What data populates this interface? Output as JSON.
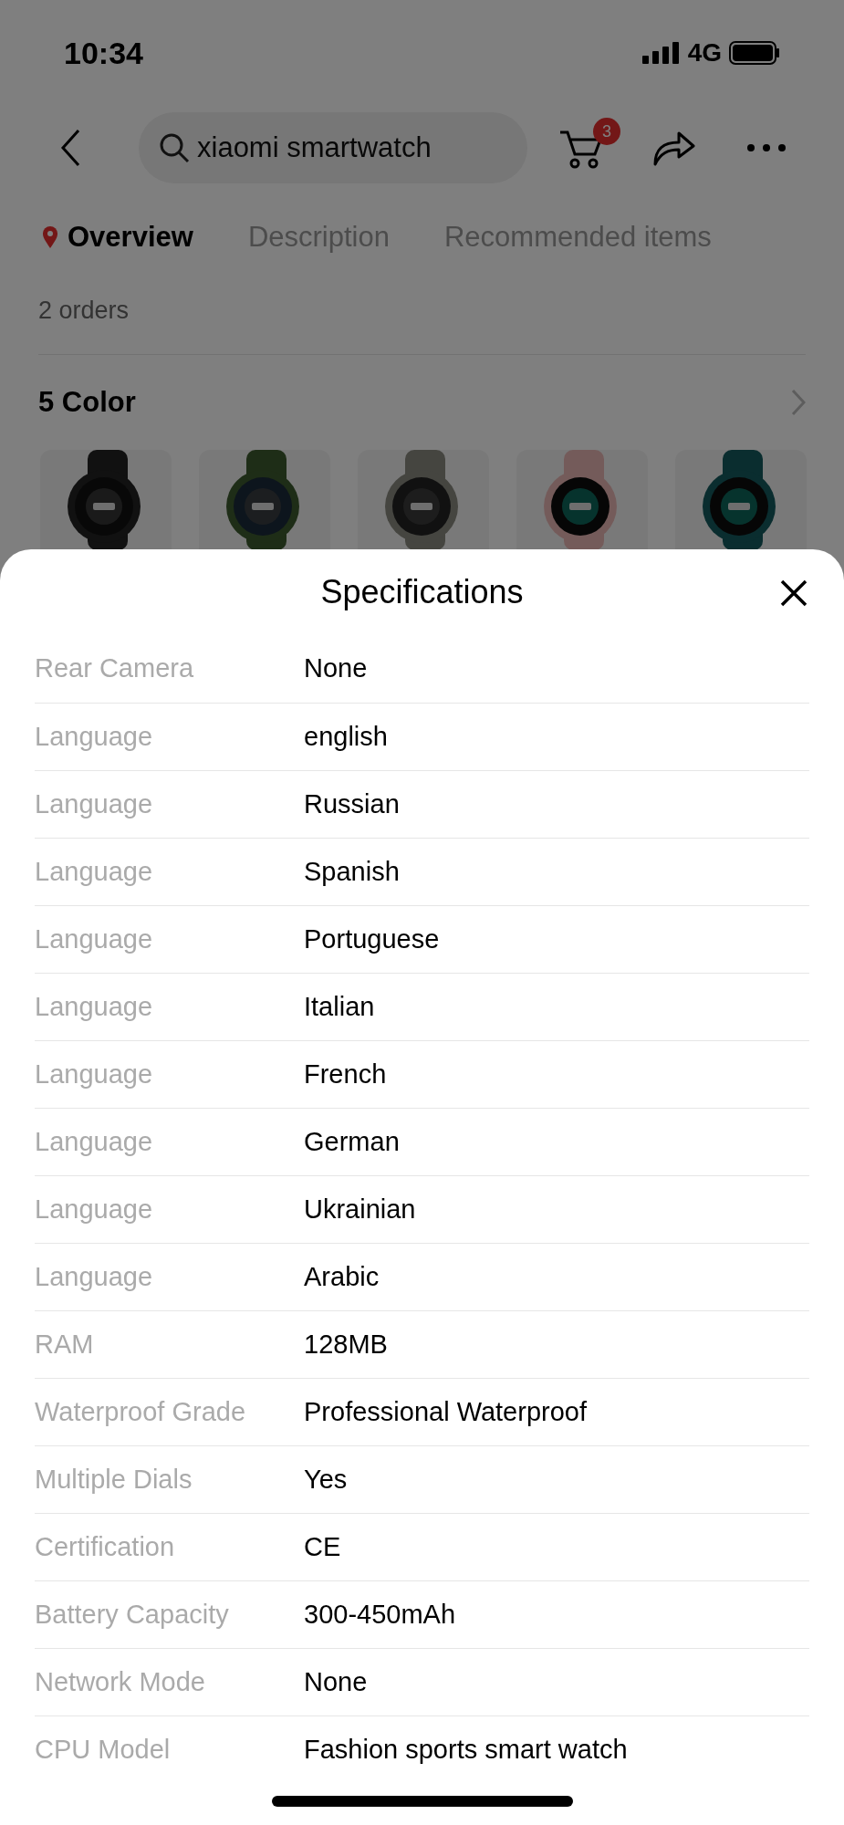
{
  "status_bar": {
    "time": "10:34",
    "network": "4G"
  },
  "search": {
    "value": "xiaomi smartwatch"
  },
  "cart_badge": "3",
  "tabs": [
    {
      "label": "Overview",
      "selected": true
    },
    {
      "label": "Description",
      "selected": false
    },
    {
      "label": "Recommended items",
      "selected": false
    }
  ],
  "orders": "2 orders",
  "color_section": {
    "title": "5 Color"
  },
  "sheet": {
    "title": "Specifications",
    "rows": [
      {
        "label": "Rear Camera",
        "value": "None"
      },
      {
        "label": "Language",
        "value": "english"
      },
      {
        "label": "Language",
        "value": "Russian"
      },
      {
        "label": "Language",
        "value": "Spanish"
      },
      {
        "label": "Language",
        "value": "Portuguese"
      },
      {
        "label": "Language",
        "value": "Italian"
      },
      {
        "label": "Language",
        "value": "French"
      },
      {
        "label": "Language",
        "value": "German"
      },
      {
        "label": "Language",
        "value": "Ukrainian"
      },
      {
        "label": "Language",
        "value": "Arabic"
      },
      {
        "label": "RAM",
        "value": "128MB"
      },
      {
        "label": "Waterproof Grade",
        "value": "Professional Waterproof"
      },
      {
        "label": "Multiple Dials",
        "value": "Yes"
      },
      {
        "label": "Certification",
        "value": "CE"
      },
      {
        "label": "Battery Capacity",
        "value": "300-450mAh"
      },
      {
        "label": "Network Mode",
        "value": "None"
      },
      {
        "label": "CPU Model",
        "value": "Fashion sports smart watch"
      }
    ]
  }
}
